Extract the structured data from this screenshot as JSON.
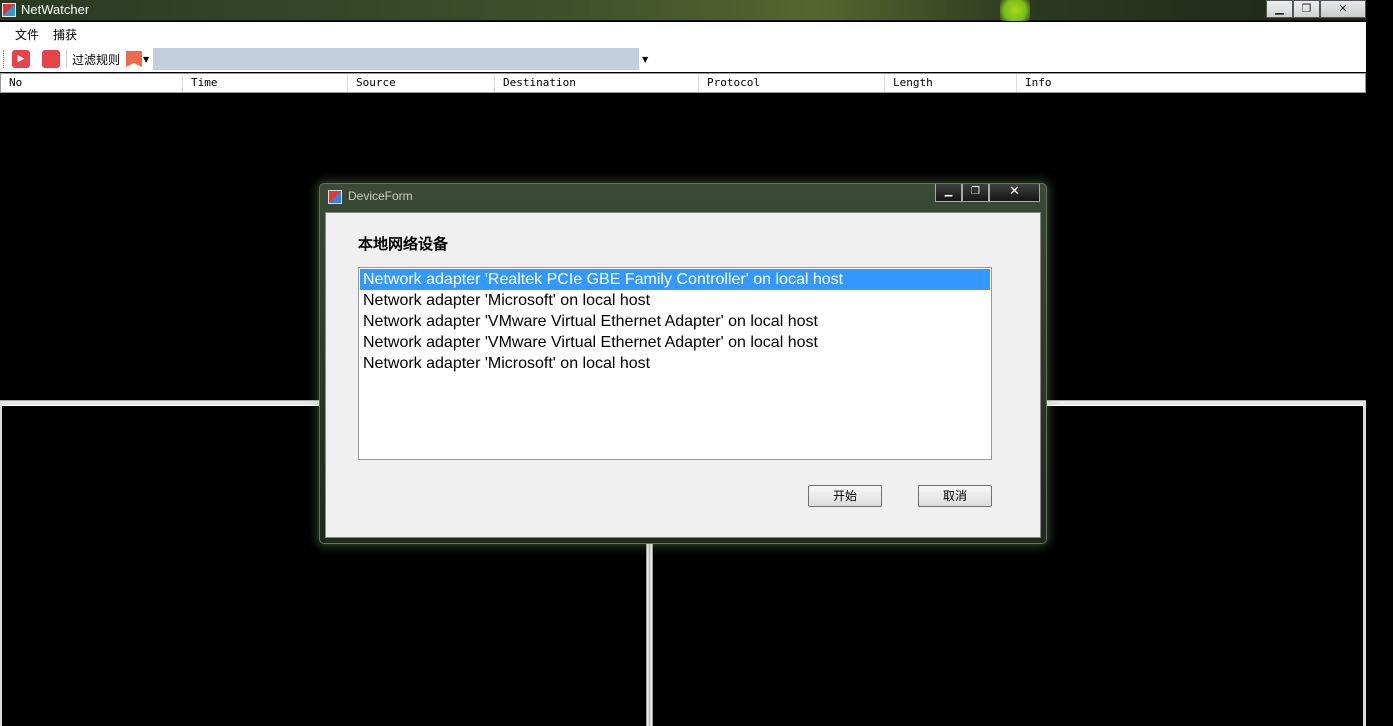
{
  "app": {
    "title": "NetWatcher"
  },
  "window_controls": {
    "minimize": "▁",
    "restore": "❐",
    "close": "✕"
  },
  "menu": {
    "items": [
      {
        "label": "文件"
      },
      {
        "label": "捕获"
      }
    ]
  },
  "toolbar": {
    "filter_label": "过滤规则",
    "filter_value": "",
    "icons": {
      "start": "play-icon",
      "stop": "stop-icon",
      "bookmark": "bookmark-icon"
    },
    "colors": {
      "buttons": "#e8434b",
      "bookmark": "#ee6a4a",
      "filter_bg": "#c2d0dd"
    }
  },
  "table": {
    "columns": [
      {
        "label": "No"
      },
      {
        "label": "Time"
      },
      {
        "label": "Source"
      },
      {
        "label": "Destination"
      },
      {
        "label": "Protocol"
      },
      {
        "label": "Length"
      },
      {
        "label": "Info"
      }
    ]
  },
  "dialog": {
    "title": "DeviceForm",
    "heading": "本地网络设备",
    "devices": [
      {
        "label": "Network adapter 'Realtek PCIe GBE Family Controller' on local host",
        "selected": true
      },
      {
        "label": "Network adapter 'Microsoft' on local host",
        "selected": false
      },
      {
        "label": "Network adapter 'VMware Virtual Ethernet Adapter' on local host",
        "selected": false
      },
      {
        "label": "Network adapter 'VMware Virtual Ethernet Adapter' on local host",
        "selected": false
      },
      {
        "label": "Network adapter 'Microsoft' on local host",
        "selected": false
      }
    ],
    "start_label": "开始",
    "cancel_label": "取消",
    "selection_color": "#3399ff"
  }
}
